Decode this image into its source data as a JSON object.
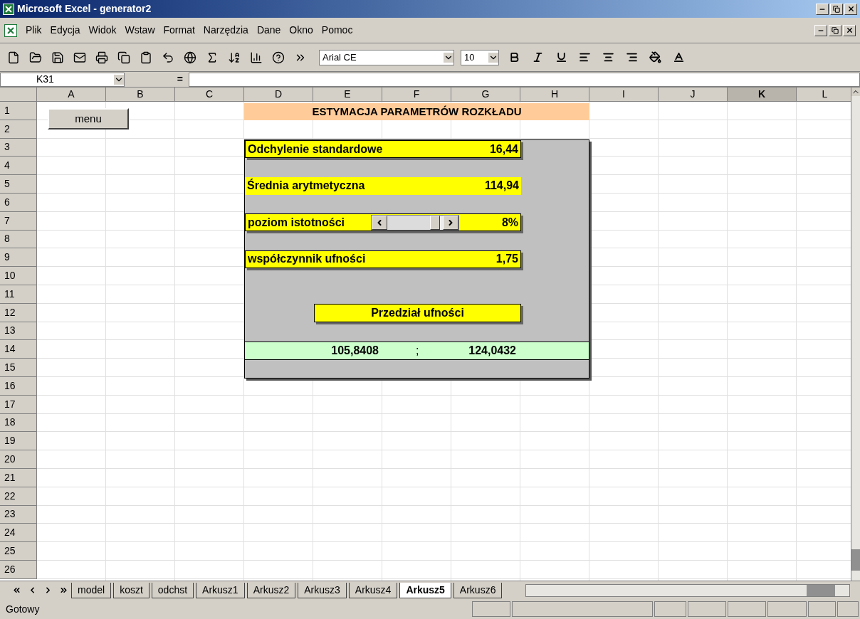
{
  "window": {
    "title": "Microsoft Excel - generator2"
  },
  "menu": {
    "items": [
      "Plik",
      "Edycja",
      "Widok",
      "Wstaw",
      "Format",
      "Narzędzia",
      "Dane",
      "Okno",
      "Pomoc"
    ]
  },
  "toolbar": {
    "font": "Arial CE",
    "size": "10"
  },
  "formula_bar": {
    "cell": "K31",
    "equals": "="
  },
  "columns": [
    {
      "label": "A",
      "selected": false
    },
    {
      "label": "B",
      "selected": false
    },
    {
      "label": "C",
      "selected": false
    },
    {
      "label": "D",
      "selected": false
    },
    {
      "label": "E",
      "selected": false
    },
    {
      "label": "F",
      "selected": false
    },
    {
      "label": "G",
      "selected": false
    },
    {
      "label": "H",
      "selected": false
    },
    {
      "label": "I",
      "selected": false
    },
    {
      "label": "J",
      "selected": false
    },
    {
      "label": "K",
      "selected": true
    },
    {
      "label": "L",
      "selected": false
    }
  ],
  "rows": [
    "1",
    "2",
    "3",
    "4",
    "5",
    "6",
    "7",
    "8",
    "9",
    "10",
    "11",
    "12",
    "13",
    "14",
    "15",
    "16",
    "17",
    "18",
    "19",
    "20",
    "21",
    "22",
    "23",
    "24",
    "25",
    "26"
  ],
  "sheet": {
    "title": "ESTYMACJA PARAMETRÓW ROZKŁADU",
    "menu_button": "menu",
    "panel": [
      {
        "kind": "value",
        "label": "Odchylenie standardowe",
        "value": "16,44",
        "bordered": true
      },
      {
        "kind": "value",
        "label": "Średnia arytmetyczna",
        "value": "114,94",
        "bordered": false
      },
      {
        "kind": "slider",
        "label": "poziom istotności",
        "value": "8%",
        "bordered": true,
        "level": 0.95
      },
      {
        "kind": "value",
        "label": "współczynnik ufności",
        "value": "1,75",
        "bordered": true
      }
    ],
    "interval_title": "Przedział ufności",
    "interval": {
      "low": "105,8408",
      "separator": ";",
      "high": "124,0432"
    }
  },
  "sheet_tabs": [
    {
      "label": "model",
      "selected": false
    },
    {
      "label": "koszt",
      "selected": false
    },
    {
      "label": "odchst",
      "selected": false
    },
    {
      "label": "Arkusz1",
      "selected": false
    },
    {
      "label": "Arkusz2",
      "selected": false
    },
    {
      "label": "Arkusz3",
      "selected": false
    },
    {
      "label": "Arkusz4",
      "selected": false
    },
    {
      "label": "Arkusz5",
      "selected": true
    },
    {
      "label": "Arkusz6",
      "selected": false
    }
  ],
  "status_bar": {
    "text": "Gotowy"
  }
}
